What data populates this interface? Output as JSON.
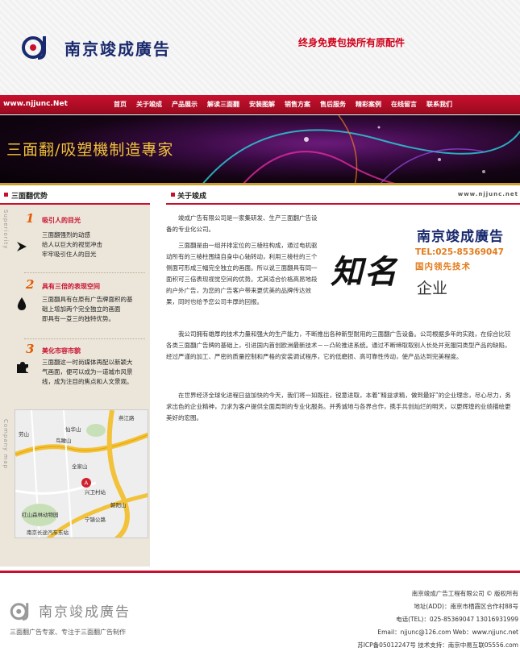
{
  "header": {
    "company_name": "南京竣成廣告",
    "slogan": "终身免费包换所有原配件"
  },
  "nav": {
    "url": "www.njjunc.Net",
    "items": [
      "首页",
      "关于竣成",
      "产品展示",
      "解读三面翻",
      "安装图解",
      "销售方案",
      "售后服务",
      "精彩案例",
      "在线留言",
      "联系我们"
    ]
  },
  "banner": {
    "title": "三面翻/吸塑機制造專家"
  },
  "left": {
    "heading": "三面翻优势",
    "side_label_1": "Superiority",
    "side_label_2": "Company map",
    "features": [
      {
        "num": "1",
        "title": "吸引人的目光",
        "lines": [
          "三面翻强烈的动感",
          "给人以巨大的视觉冲击",
          "牢牢吸引住人的目光"
        ]
      },
      {
        "num": "2",
        "title": "具有三倍的表现空间",
        "lines": [
          "三面翻具有在原有广告牌面积的基",
          "础上增加两个完全独立的画面",
          "即具有一芟三的独特优势。"
        ]
      },
      {
        "num": "3",
        "title": "美化市容市貌",
        "lines": [
          "三面翻这一时尚媒体再配以新颖大",
          "气画面，便可以成为一道城市风景",
          "线，成为注目的焦点和人文景观。"
        ]
      }
    ],
    "map_labels": [
      "劳山",
      "仙华山",
      "鸟瞰山",
      "全家山",
      "兴卫村站",
      "朝阳山",
      "红山森林动物园",
      "南京长途汽车东站",
      "宁镇公路",
      "燕江路"
    ]
  },
  "right": {
    "heading": "关于竣成",
    "url": "www.njjunc.net",
    "paragraphs": [
      "竣成广告有限公司是一家集研发、生产三面翻广告设备的专业化公司。",
      "三面翻是由一组并排定位的三棱柱构成，通过电机驱动所有的三棱柱围绕自身中心轴转动，利用三棱柱的三个侧面可形成三幅完全独立的画面。所以说三面翻具有同一面积可三倍表现视觉空间的优势。尤其适合价格高昂地段的户外广告，为您的广告客户带来更优美的品牌传达效果，同时也给予您公司丰厚的回报。",
      "我公司拥有雄厚的技术力量和强大的生产能力，不断推出各种新型耐用的三面翻广告设备。公司根据多年的实践，在综合比较各类三面翻广告牌的基础上，引进国内首创欧洲最新技术－－凸轮推进系统。通过不断缔取取别人长处并克服同类型产品的缺陷，经过严谨的加工、严密的质量控制和严格的安装调试程序，它的低磨损、高可靠性传动，使产品达到完美程度。",
      "在世界经济全球化进程日益加快的今天，我们将一如既往，锐意进取，本着“精益求精，做到最好”的企业理念，尽心尽力，务求出色的企业精神，力求为客户提供全面周到的专业化服务。并秀诚地与各界合作，携手共创灿烂的明天，以更辉煌的业绩描绘更美好的宏图。"
    ],
    "badge": {
      "name": "南京竣成廣告",
      "tel": "TEL:025-85369047",
      "tech": "国内领先技术",
      "big": "知名",
      "sub": "企业"
    }
  },
  "footer": {
    "logo_text": "南京竣成廣告",
    "tagline": "三面翻广告专家、专注于三面翻广告制作",
    "lines": [
      "南京竣成广告工程有限公司 © 版权所有",
      "地址(ADD)：南京市栖霞区合作村88号",
      "电话(TEL)：025-85369047 13016931999",
      "Email：njjunc@126.com Web：www.njjunc.net",
      "苏ICP备05012247号  技术支持：南京中易互联05556.com"
    ]
  },
  "colors": {
    "brand_red": "#c8102e",
    "navy": "#1a2a6e",
    "orange": "#e35a00",
    "gold": "#f2c23a"
  }
}
